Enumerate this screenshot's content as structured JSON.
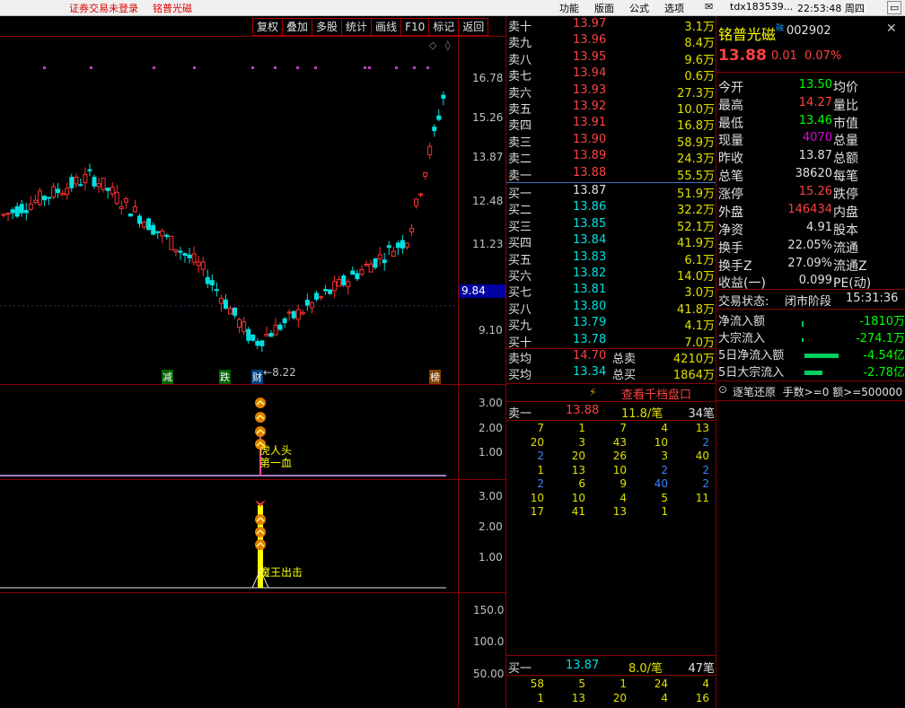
{
  "topbar": {
    "warning": "证券交易未登录",
    "stock": "铭普光磁",
    "menus": [
      "功能",
      "版面",
      "公式",
      "选项"
    ],
    "user": "tdx183539...",
    "time": "22:53:48 周四"
  },
  "chart_buttons": [
    "复权",
    "叠加",
    "多股",
    "统计",
    "画线",
    "F10",
    "标记",
    "返回"
  ],
  "price_axis": [
    "16.78",
    "15.26",
    "13.87",
    "12.48",
    "11.23",
    "9.10"
  ],
  "current_price_tag": "9.84",
  "low_label": "8.22",
  "event_markers": [
    "减",
    "跌",
    "财",
    "榜"
  ],
  "ind1_axis": [
    "3.00",
    "2.00",
    "1.00"
  ],
  "ind1_label_line1": "虎人头",
  "ind1_label_line2": "第一血",
  "ind2_axis": [
    "3.00",
    "2.00",
    "1.00"
  ],
  "ind2_label": "魔王出击",
  "vol_axis": [
    "150.0",
    "100.0",
    "50.00"
  ],
  "sell_levels": [
    {
      "name": "卖十",
      "price": "13.97",
      "vol": "3.1万"
    },
    {
      "name": "卖九",
      "price": "13.96",
      "vol": "8.4万"
    },
    {
      "name": "卖八",
      "price": "13.95",
      "vol": "9.6万"
    },
    {
      "name": "卖七",
      "price": "13.94",
      "vol": "0.6万"
    },
    {
      "name": "卖六",
      "price": "13.93",
      "vol": "27.3万"
    },
    {
      "name": "卖五",
      "price": "13.92",
      "vol": "10.0万"
    },
    {
      "name": "卖四",
      "price": "13.91",
      "vol": "16.8万"
    },
    {
      "name": "卖三",
      "price": "13.90",
      "vol": "58.9万"
    },
    {
      "name": "卖二",
      "price": "13.89",
      "vol": "24.3万"
    },
    {
      "name": "卖一",
      "price": "13.88",
      "vol": "55.5万"
    }
  ],
  "buy_levels": [
    {
      "name": "买一",
      "price": "13.87",
      "vol": "51.9万"
    },
    {
      "name": "买二",
      "price": "13.86",
      "vol": "32.2万"
    },
    {
      "name": "买三",
      "price": "13.85",
      "vol": "52.1万"
    },
    {
      "name": "买四",
      "price": "13.84",
      "vol": "41.9万"
    },
    {
      "name": "买五",
      "price": "13.83",
      "vol": "6.1万"
    },
    {
      "name": "买六",
      "price": "13.82",
      "vol": "14.0万"
    },
    {
      "name": "买七",
      "price": "13.81",
      "vol": "3.0万"
    },
    {
      "name": "买八",
      "price": "13.80",
      "vol": "41.8万"
    },
    {
      "name": "买九",
      "price": "13.79",
      "vol": "4.1万"
    },
    {
      "name": "买十",
      "price": "13.78",
      "vol": "7.0万"
    }
  ],
  "sell_avg": {
    "label": "卖均",
    "price": "14.70",
    "tlabel": "总卖",
    "vol": "4210万"
  },
  "buy_avg": {
    "label": "买均",
    "price": "13.34",
    "tlabel": "总买",
    "vol": "1864万"
  },
  "thousand_btn": "查看千档盘口",
  "queue_sell": {
    "label": "卖一",
    "price": "13.88",
    "vol": "11.8/笔",
    "count": "34笔",
    "rows": [
      [
        "7",
        "1",
        "7",
        "4",
        "13"
      ],
      [
        "20",
        "3",
        "43",
        "10",
        "2"
      ],
      [
        "2",
        "20",
        "26",
        "3",
        "40"
      ],
      [
        "1",
        "13",
        "10",
        "2",
        "2"
      ],
      [
        "2",
        "6",
        "9",
        "40",
        "2"
      ],
      [
        "10",
        "10",
        "4",
        "5",
        "11"
      ],
      [
        "17",
        "41",
        "13",
        "1",
        ""
      ]
    ]
  },
  "queue_buy": {
    "label": "买一",
    "price": "13.87",
    "vol": "8.0/笔",
    "count": "47笔",
    "rows": [
      [
        "58",
        "5",
        "1",
        "24",
        "4"
      ],
      [
        "1",
        "13",
        "20",
        "4",
        "16"
      ]
    ]
  },
  "quote": {
    "name": "铭普光磁",
    "code": "002902",
    "price": "13.88",
    "chg": "0.01",
    "pct": "0.07%"
  },
  "stats": [
    {
      "l": "今开",
      "v": "13.50",
      "r": "均价"
    },
    {
      "l": "最高",
      "v": "14.27",
      "r": "量比"
    },
    {
      "l": "最低",
      "v": "13.46",
      "r": "市值"
    },
    {
      "l": "现量",
      "v": "4070",
      "r": "总量"
    },
    {
      "l": "昨收",
      "v": "13.87",
      "r": "总额"
    },
    {
      "l": "总笔",
      "v": "38620",
      "r": "每笔"
    },
    {
      "l": "涨停",
      "v": "15.26",
      "r": "跌停"
    },
    {
      "l": "外盘",
      "v": "146434",
      "r": "内盘"
    },
    {
      "l": "净资",
      "v": "4.91",
      "r": "股本"
    },
    {
      "l": "换手",
      "v": "22.05%",
      "r": "流通"
    },
    {
      "l": "换手Z",
      "v": "27.09%",
      "r": "流通Z"
    },
    {
      "l": "收益(一)",
      "v": "0.099",
      "r": "PE(动)"
    }
  ],
  "trade_state": {
    "label": "交易状态:",
    "value": "闭市阶段",
    "time": "15:31:36"
  },
  "flows": [
    {
      "l": "净流入额",
      "v": "-1810万"
    },
    {
      "l": "大宗流入",
      "v": "-274.1万"
    },
    {
      "l": "5日净流入额",
      "v": "-4.54亿"
    },
    {
      "l": "5日大宗流入",
      "v": "-2.78亿"
    }
  ],
  "tick_filter": "逐笔还原  手数>=0 额>=500000"
}
